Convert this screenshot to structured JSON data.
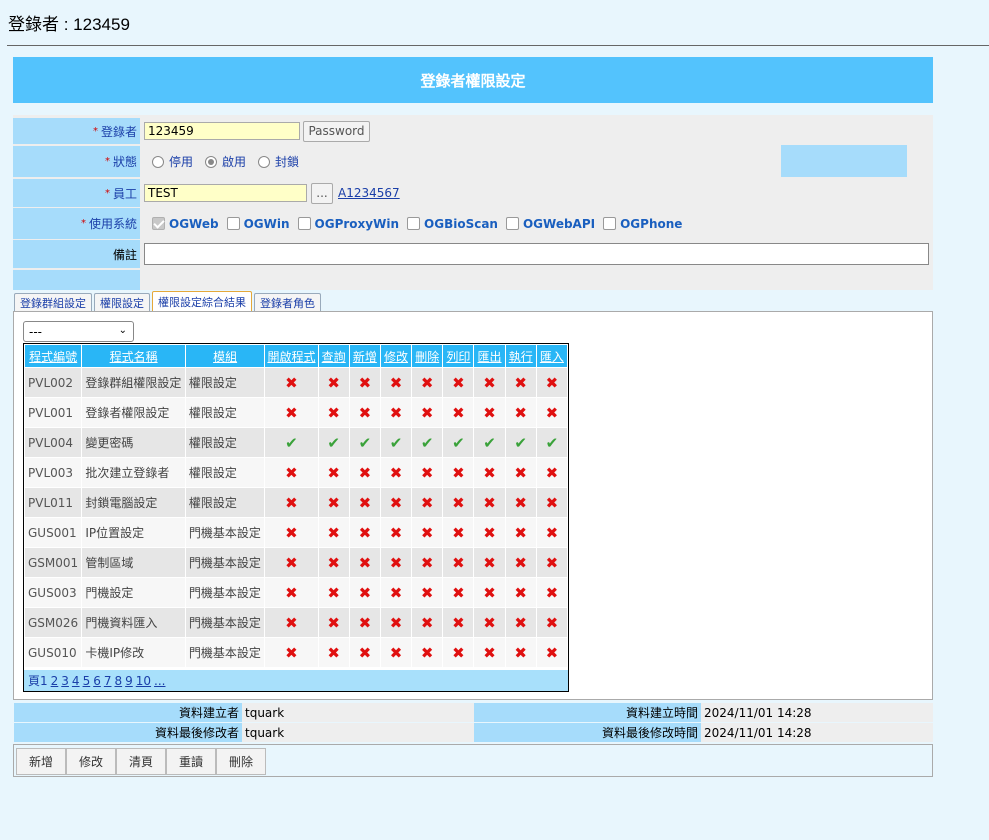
{
  "header": {
    "login_label": "登錄者 : 123459"
  },
  "title": "登錄者權限設定",
  "form": {
    "login": {
      "label": "登錄者",
      "value": "123459",
      "password_button": "Password"
    },
    "status": {
      "label": "狀態",
      "options": [
        "停用",
        "啟用",
        "封鎖"
      ],
      "selected": "啟用"
    },
    "employee": {
      "label": "員工",
      "value": "TEST",
      "lookup_button": "...",
      "link": "A1234567"
    },
    "systems": {
      "label": "使用系統",
      "items": [
        {
          "label": "OGWeb",
          "checked": true
        },
        {
          "label": "OGWin",
          "checked": false
        },
        {
          "label": "OGProxyWin",
          "checked": false
        },
        {
          "label": "OGBioScan",
          "checked": false
        },
        {
          "label": "OGWebAPI",
          "checked": false
        },
        {
          "label": "OGPhone",
          "checked": false
        }
      ]
    },
    "remark": {
      "label": "備註",
      "value": ""
    }
  },
  "tabs": [
    "登錄群組設定",
    "權限設定",
    "權限設定綜合結果",
    "登錄者角色"
  ],
  "active_tab": "權限設定綜合結果",
  "filter": {
    "selected": "---"
  },
  "grid": {
    "columns": [
      "程式編號",
      "程式名稱",
      "模組",
      "開啟程式",
      "查詢",
      "新增",
      "修改",
      "刪除",
      "列印",
      "匯出",
      "執行",
      "匯入"
    ],
    "rows": [
      {
        "id": "PVL002",
        "name": "登錄群組權限設定",
        "module": "權限設定",
        "perms": [
          0,
          0,
          0,
          0,
          0,
          0,
          0,
          0,
          0
        ]
      },
      {
        "id": "PVL001",
        "name": "登錄者權限設定",
        "module": "權限設定",
        "perms": [
          0,
          0,
          0,
          0,
          0,
          0,
          0,
          0,
          0
        ]
      },
      {
        "id": "PVL004",
        "name": "變更密碼",
        "module": "權限設定",
        "perms": [
          1,
          1,
          1,
          1,
          1,
          1,
          1,
          1,
          1
        ]
      },
      {
        "id": "PVL003",
        "name": "批次建立登錄者",
        "module": "權限設定",
        "perms": [
          0,
          0,
          0,
          0,
          0,
          0,
          0,
          0,
          0
        ]
      },
      {
        "id": "PVL011",
        "name": "封鎖電腦設定",
        "module": "權限設定",
        "perms": [
          0,
          0,
          0,
          0,
          0,
          0,
          0,
          0,
          0
        ]
      },
      {
        "id": "GUS001",
        "name": "IP位置設定",
        "module": "門機基本設定",
        "perms": [
          0,
          0,
          0,
          0,
          0,
          0,
          0,
          0,
          0
        ]
      },
      {
        "id": "GSM001",
        "name": "管制區域",
        "module": "門機基本設定",
        "perms": [
          0,
          0,
          0,
          0,
          0,
          0,
          0,
          0,
          0
        ]
      },
      {
        "id": "GUS003",
        "name": "門機設定",
        "module": "門機基本設定",
        "perms": [
          0,
          0,
          0,
          0,
          0,
          0,
          0,
          0,
          0
        ]
      },
      {
        "id": "GSM026",
        "name": "門機資料匯入",
        "module": "門機基本設定",
        "perms": [
          0,
          0,
          0,
          0,
          0,
          0,
          0,
          0,
          0
        ]
      },
      {
        "id": "GUS010",
        "name": "卡機IP修改",
        "module": "門機基本設定",
        "perms": [
          0,
          0,
          0,
          0,
          0,
          0,
          0,
          0,
          0
        ]
      }
    ],
    "pager": {
      "label": "頁1",
      "pages": [
        "2",
        "3",
        "4",
        "5",
        "6",
        "7",
        "8",
        "9",
        "10",
        "..."
      ]
    }
  },
  "audit": {
    "created_by_label": "資料建立者",
    "created_by": "tquark",
    "created_time_label": "資料建立時間",
    "created_time": "2024/11/01 14:28",
    "modified_by_label": "資料最後修改者",
    "modified_by": "tquark",
    "modified_time_label": "資料最後修改時間",
    "modified_time": "2024/11/01 14:28"
  },
  "toolbar": {
    "buttons": [
      "新增",
      "修改",
      "清頁",
      "重讀",
      "刪除"
    ]
  },
  "icons": {
    "deny": "x-mark-icon",
    "allow": "check-mark-icon"
  },
  "colors": {
    "title_bar": "#53c3fd",
    "grid_header": "#29b6f6",
    "deny": "#e01010",
    "allow": "#3aa23a"
  }
}
